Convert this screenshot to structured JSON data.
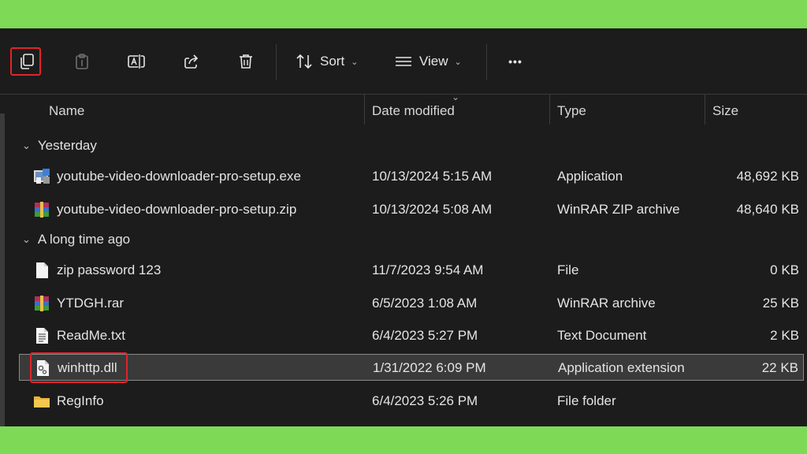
{
  "toolbar": {
    "sort_label": "Sort",
    "view_label": "View",
    "more_label": "•••"
  },
  "columns": {
    "name": "Name",
    "date": "Date modified",
    "type": "Type",
    "size": "Size"
  },
  "groups": {
    "recent": "Yesterday",
    "older": "A long time ago"
  },
  "files": [
    {
      "name": "youtube-video-downloader-pro-setup.exe",
      "date": "10/13/2024 5:15 AM",
      "type": "Application",
      "size": "48,692 KB",
      "icon": "exe-installer-icon"
    },
    {
      "name": "youtube-video-downloader-pro-setup.zip",
      "date": "10/13/2024 5:08 AM",
      "type": "WinRAR ZIP archive",
      "size": "48,640 KB",
      "icon": "winrar-archive-icon"
    },
    {
      "name": "zip password 123",
      "date": "11/7/2023 9:54 AM",
      "type": "File",
      "size": "0 KB",
      "icon": "blank-file-icon"
    },
    {
      "name": "YTDGH.rar",
      "date": "6/5/2023 1:08 AM",
      "type": "WinRAR archive",
      "size": "25 KB",
      "icon": "winrar-archive-icon"
    },
    {
      "name": "ReadMe.txt",
      "date": "6/4/2023 5:27 PM",
      "type": "Text Document",
      "size": "2 KB",
      "icon": "text-file-icon"
    },
    {
      "name": "winhttp.dll",
      "date": "1/31/2022 6:09 PM",
      "type": "Application extension",
      "size": "22 KB",
      "icon": "dll-gear-file-icon"
    },
    {
      "name": "RegInfo",
      "date": "6/4/2023 5:26 PM",
      "type": "File folder",
      "size": "",
      "icon": "folder-icon"
    }
  ],
  "colors": {
    "background": "#7ed957",
    "window": "#1c1c1c",
    "highlight": "#e0242a",
    "selected_row": "#3a3a3a"
  }
}
